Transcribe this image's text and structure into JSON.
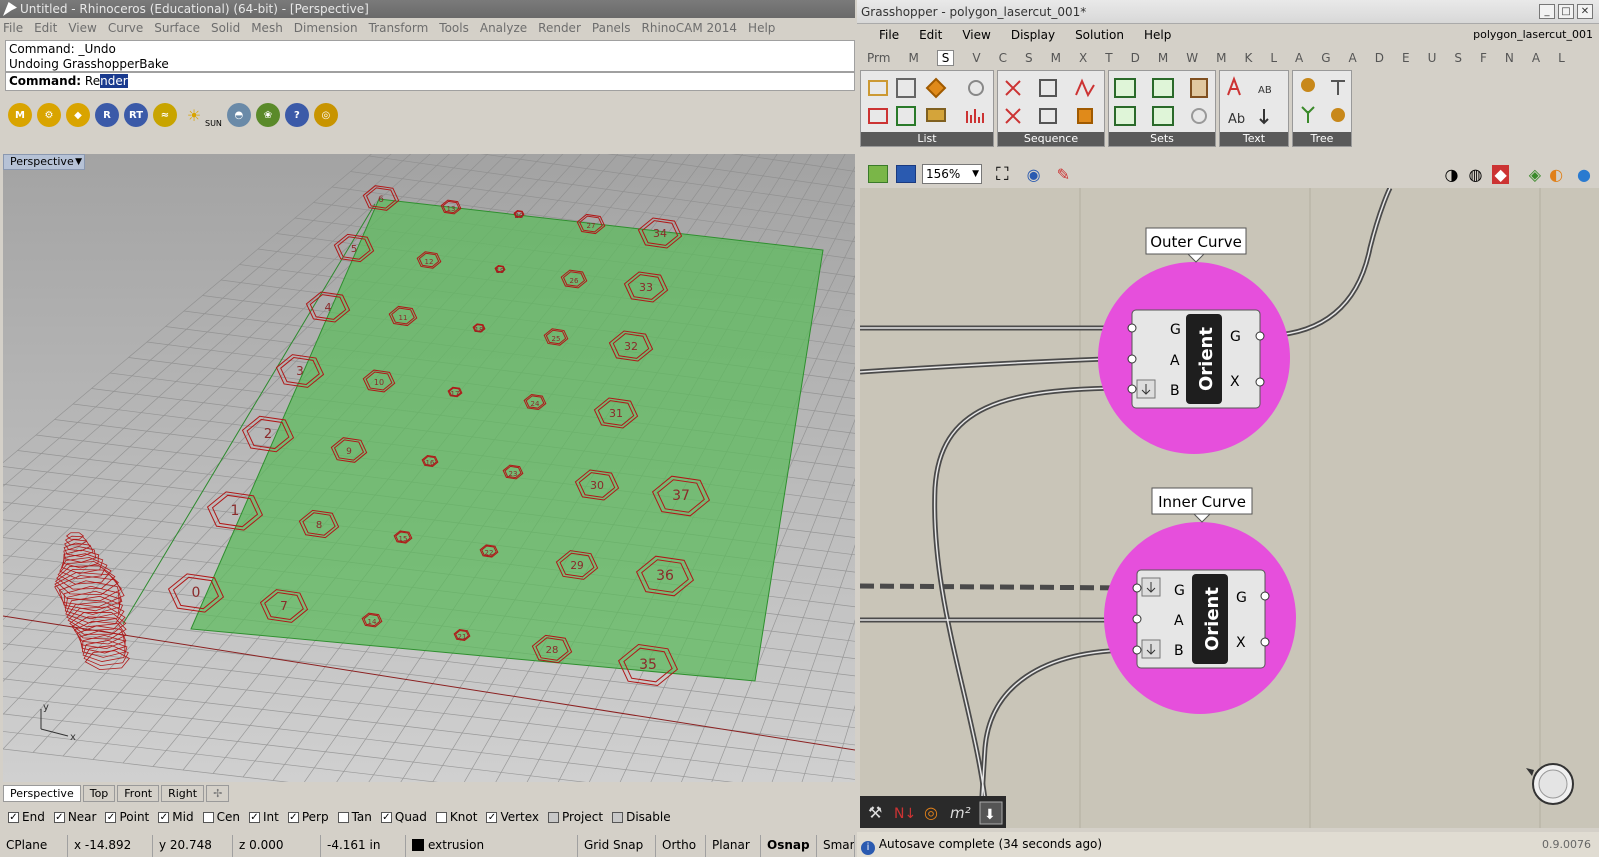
{
  "rhino": {
    "title": "Untitled - Rhinoceros (Educational) (64-bit) - [Perspective]",
    "menu": [
      "File",
      "Edit",
      "View",
      "Curve",
      "Surface",
      "Solid",
      "Mesh",
      "Dimension",
      "Transform",
      "Tools",
      "Analyze",
      "Render",
      "Panels",
      "RhinoCAM 2014",
      "Help"
    ],
    "command_history": [
      "Command: _Undo",
      "Undoing GrasshopperBake"
    ],
    "command_prompt": "Command:",
    "command_typed": "Re",
    "command_selected": "nder",
    "toolbar_icons": [
      {
        "name": "materials-icon",
        "glyph": "M",
        "color": "#d9a400"
      },
      {
        "name": "render-tools-icon",
        "glyph": "⚙",
        "color": "#d9a400"
      },
      {
        "name": "tag-icon",
        "glyph": "◆",
        "color": "#d9a400"
      },
      {
        "name": "render-icon",
        "glyph": "R",
        "color": "#3b5aa8"
      },
      {
        "name": "realtime-render-icon",
        "glyph": "RT",
        "color": "#3b5aa8"
      },
      {
        "name": "environment-icon",
        "glyph": "≈",
        "color": "#c8a400"
      },
      {
        "name": "sun-icon",
        "glyph": "☀",
        "color": "#d9a400"
      },
      {
        "name": "light-icon",
        "glyph": "◓",
        "color": "#6a8aa8"
      },
      {
        "name": "plant-icon",
        "glyph": "❀",
        "color": "#5a8a2a"
      },
      {
        "name": "help-icon",
        "glyph": "?",
        "color": "#3b5aa8"
      },
      {
        "name": "target-icon",
        "glyph": "◎",
        "color": "#c89400"
      }
    ],
    "sun_label": "SUN",
    "viewport_label": "Perspective",
    "viewport_tabs": [
      "Perspective",
      "Top",
      "Front",
      "Right"
    ],
    "osnap": [
      {
        "label": "End",
        "checked": true
      },
      {
        "label": "Near",
        "checked": true
      },
      {
        "label": "Point",
        "checked": true
      },
      {
        "label": "Mid",
        "checked": true
      },
      {
        "label": "Cen",
        "checked": false
      },
      {
        "label": "Int",
        "checked": true
      },
      {
        "label": "Perp",
        "checked": true
      },
      {
        "label": "Tan",
        "checked": false
      },
      {
        "label": "Quad",
        "checked": true
      },
      {
        "label": "Knot",
        "checked": false
      },
      {
        "label": "Vertex",
        "checked": true
      },
      {
        "label": "Project",
        "checked": false
      },
      {
        "label": "Disable",
        "checked": false
      }
    ],
    "status": {
      "cplane": "CPlane",
      "x": "x -14.892",
      "y": "y 20.748",
      "z": "z 0.000",
      "dist": "-4.161 in",
      "layer": "extrusion",
      "grid_snap": "Grid Snap",
      "ortho": "Ortho",
      "planar": "Planar",
      "osnap": "Osnap",
      "smart": "Smar"
    },
    "polygon_numbers": [
      "0",
      "1",
      "2",
      "3",
      "4",
      "5",
      "6",
      "7",
      "8",
      "9",
      "10",
      "11",
      "12",
      "13",
      "14",
      "15",
      "16",
      "17",
      "18",
      "19",
      "20",
      "21",
      "22",
      "23",
      "24",
      "25",
      "26",
      "27",
      "28",
      "29",
      "30",
      "31",
      "32",
      "33",
      "34",
      "35",
      "36",
      "37"
    ],
    "axis_labels": {
      "y": "y",
      "x": "x"
    }
  },
  "gh": {
    "title": "Grasshopper - polygon_lasercut_001*",
    "menu": [
      "File",
      "Edit",
      "View",
      "Display",
      "Solution",
      "Help"
    ],
    "filename": "polygon_lasercut_001",
    "tabs": [
      "Prm",
      "M",
      "S",
      "V",
      "C",
      "S",
      "M",
      "X",
      "T",
      "D",
      "M",
      "W",
      "M",
      "K",
      "L",
      "A",
      "G",
      "A",
      "D",
      "E",
      "U",
      "S",
      "F",
      "N",
      "A",
      "L"
    ],
    "active_tab": "S",
    "ribbon_groups": [
      "List",
      "Sequence",
      "Sets",
      "Text",
      "Tree"
    ],
    "zoom": "156%",
    "node1": {
      "label": "Outer Curve",
      "title": "Orient",
      "inputs": [
        "G",
        "A",
        "B"
      ],
      "outputs": [
        "G",
        "X"
      ]
    },
    "node2": {
      "label": "Inner Curve",
      "title": "Orient",
      "inputs": [
        "G",
        "A",
        "B"
      ],
      "outputs": [
        "G",
        "X"
      ]
    },
    "status": "Autosave complete (34 seconds ago)",
    "version": "0.9.0076",
    "colors": {
      "node_highlight": "#e64fdc",
      "canvas": "#c9c5b8",
      "node_title_bg": "#1e1e1e"
    }
  }
}
